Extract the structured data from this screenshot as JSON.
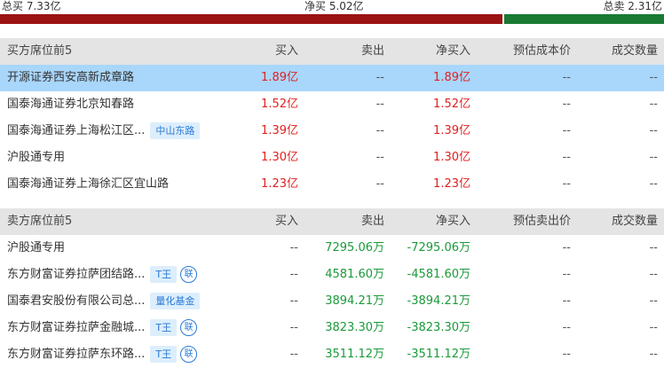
{
  "summary": {
    "total_buy": "总买 7.33亿",
    "net_buy": "净买 5.02亿",
    "total_sell": "总卖 2.31亿",
    "buy_share": 0.757
  },
  "buy_section": {
    "headers": [
      "买方席位前5",
      "买入",
      "卖出",
      "净买入",
      "预估成本价",
      "成交数量"
    ],
    "rows": [
      {
        "name": "开源证券西安高新成章路",
        "buy": "1.89亿",
        "sell": "--",
        "net": "1.89亿",
        "cost": "--",
        "qty": "--",
        "tags": []
      },
      {
        "name": "国泰海通证券北京知春路",
        "buy": "1.52亿",
        "sell": "--",
        "net": "1.52亿",
        "cost": "--",
        "qty": "--",
        "tags": []
      },
      {
        "name": "国泰海通证券上海松江区...",
        "buy": "1.39亿",
        "sell": "--",
        "net": "1.39亿",
        "cost": "--",
        "qty": "--",
        "tags": [
          "中山东路"
        ]
      },
      {
        "name": "沪股通专用",
        "buy": "1.30亿",
        "sell": "--",
        "net": "1.30亿",
        "cost": "--",
        "qty": "--",
        "tags": []
      },
      {
        "name": "国泰海通证券上海徐汇区宜山路",
        "buy": "1.23亿",
        "sell": "--",
        "net": "1.23亿",
        "cost": "--",
        "qty": "--",
        "tags": []
      }
    ]
  },
  "sell_section": {
    "headers": [
      "卖方席位前5",
      "买入",
      "卖出",
      "净买入",
      "预估卖出价",
      "成交数量"
    ],
    "rows": [
      {
        "name": "沪股通专用",
        "buy": "--",
        "sell": "7295.06万",
        "net": "-7295.06万",
        "cost": "--",
        "qty": "--",
        "tags": []
      },
      {
        "name": "东方财富证券拉萨团结路...",
        "buy": "--",
        "sell": "4581.60万",
        "net": "-4581.60万",
        "cost": "--",
        "qty": "--",
        "tags": [
          "T王",
          "联"
        ]
      },
      {
        "name": "国泰君安股份有限公司总...",
        "buy": "--",
        "sell": "3894.21万",
        "net": "-3894.21万",
        "cost": "--",
        "qty": "--",
        "tags": [
          "量化基金"
        ]
      },
      {
        "name": "东方财富证券拉萨金融城...",
        "buy": "--",
        "sell": "3823.30万",
        "net": "-3823.30万",
        "cost": "--",
        "qty": "--",
        "tags": [
          "T王",
          "联"
        ]
      },
      {
        "name": "东方财富证券拉萨东环路...",
        "buy": "--",
        "sell": "3511.12万",
        "net": "-3511.12万",
        "cost": "--",
        "qty": "--",
        "tags": [
          "T王",
          "联"
        ]
      }
    ]
  },
  "colors": {
    "buy": "#e02020",
    "sell": "#1a9a3a",
    "highlight": "#a9d6fb"
  }
}
